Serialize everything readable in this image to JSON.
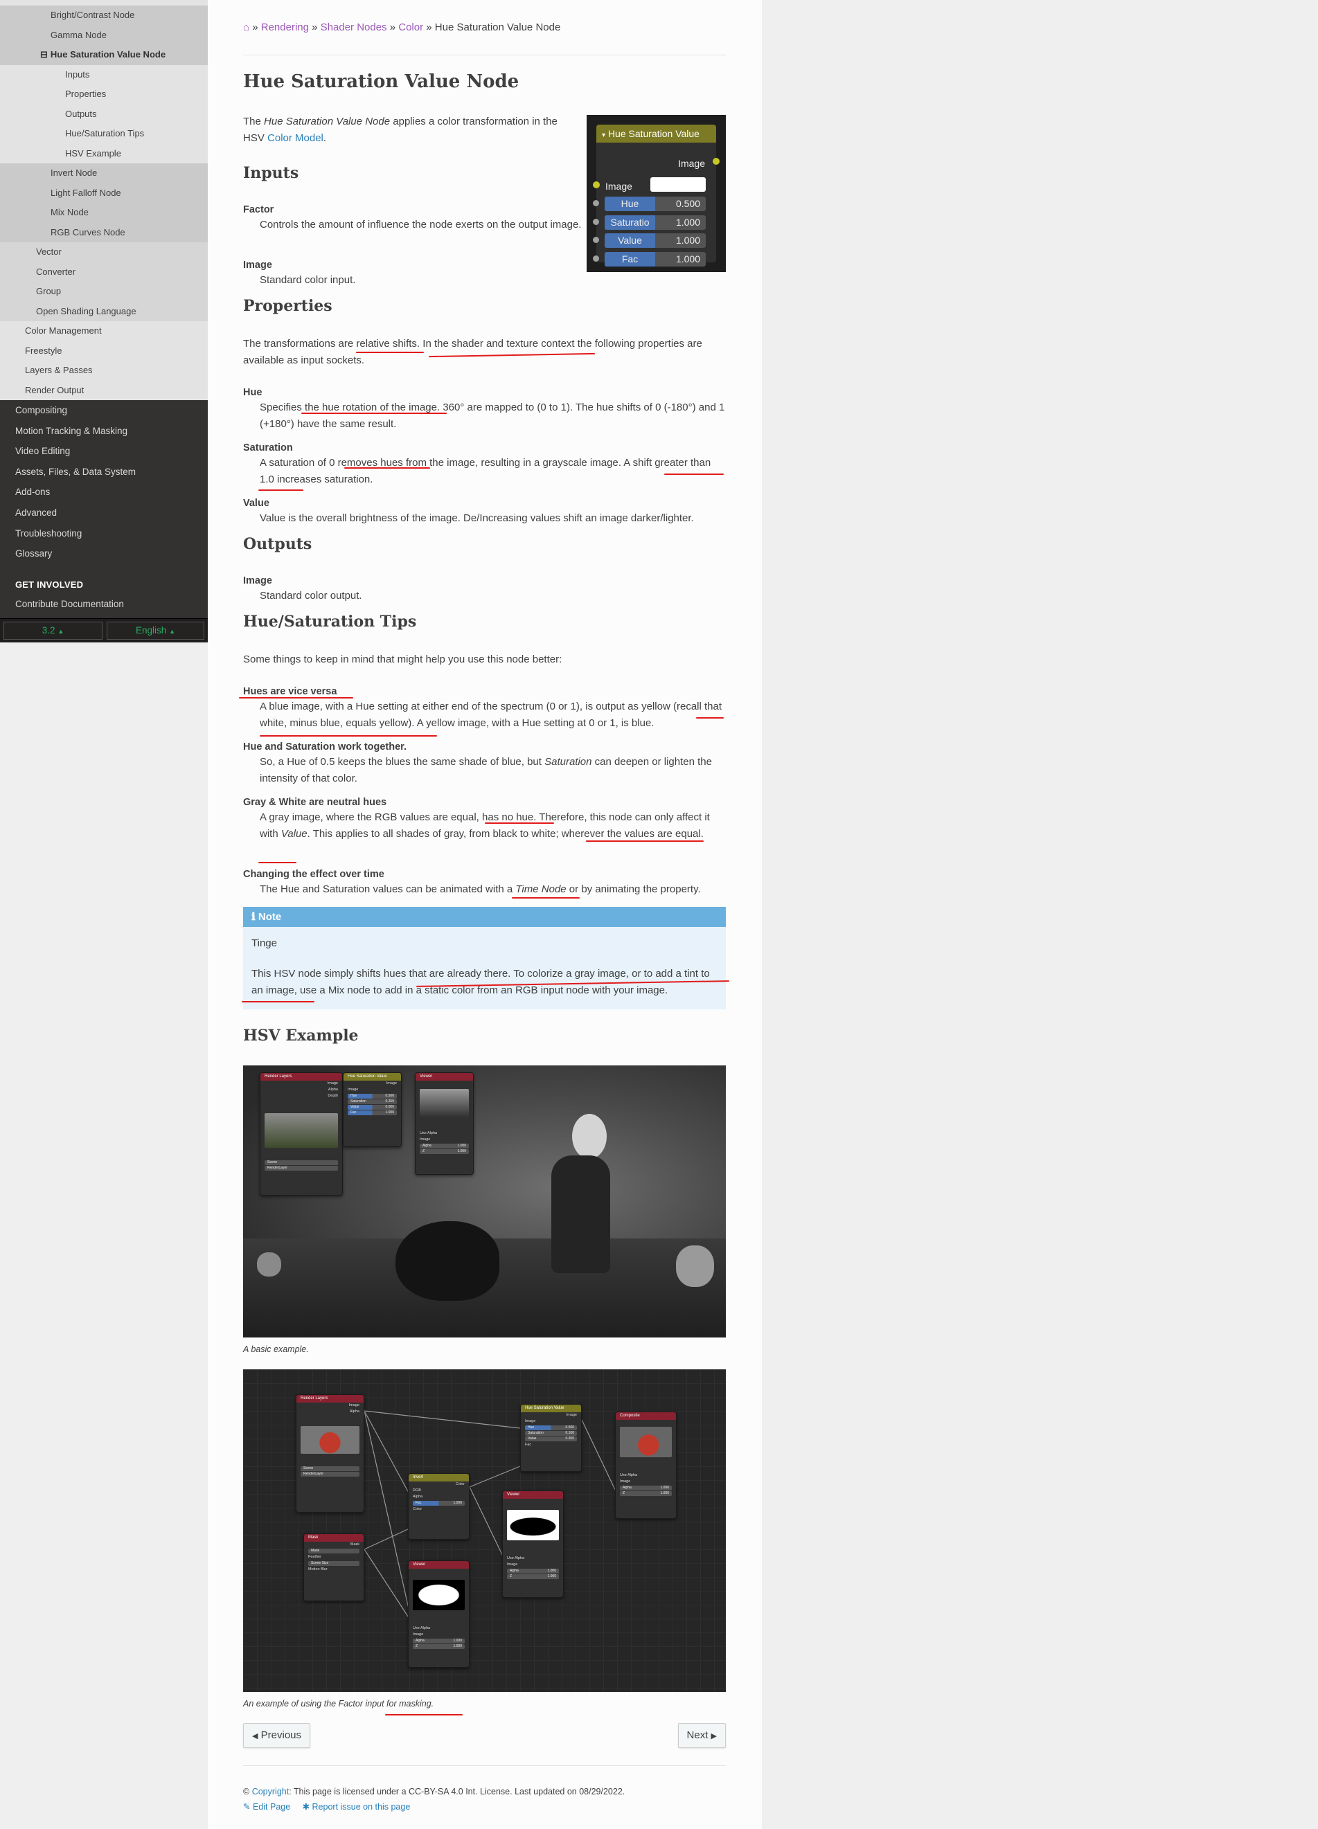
{
  "sidebar": {
    "items": [
      {
        "label": "Bright/Contrast Node",
        "level": 3
      },
      {
        "label": "Gamma Node",
        "level": 3
      },
      {
        "label": "Hue Saturation Value Node",
        "level": 3,
        "current": true,
        "toggle": "⊟"
      },
      {
        "label": "Inputs",
        "level": 4
      },
      {
        "label": "Properties",
        "level": 4
      },
      {
        "label": "Outputs",
        "level": 4
      },
      {
        "label": "Hue/Saturation Tips",
        "level": 4
      },
      {
        "label": "HSV Example",
        "level": 4
      },
      {
        "label": "Invert Node",
        "level": 3
      },
      {
        "label": "Light Falloff Node",
        "level": 3
      },
      {
        "label": "Mix Node",
        "level": 3
      },
      {
        "label": "RGB Curves Node",
        "level": 3
      },
      {
        "label": "Vector",
        "level": 2
      },
      {
        "label": "Converter",
        "level": 2
      },
      {
        "label": "Group",
        "level": 2
      },
      {
        "label": "Open Shading Language",
        "level": 2
      },
      {
        "label": "Color Management",
        "level": 1
      },
      {
        "label": "Freestyle",
        "level": 1
      },
      {
        "label": "Layers & Passes",
        "level": 1
      },
      {
        "label": "Render Output",
        "level": 1
      }
    ],
    "top_items": [
      "Compositing",
      "Motion Tracking & Masking",
      "Video Editing",
      "Assets, Files, & Data System",
      "Add-ons",
      "Advanced",
      "Troubleshooting",
      "Glossary"
    ],
    "caption": "GET INVOLVED",
    "contribute": "Contribute Documentation",
    "version": "3.2",
    "language": "English",
    "caret": "▲"
  },
  "breadcrumb": {
    "home_icon": "⌂",
    "sep": "»",
    "items": [
      "Rendering",
      "Shader Nodes",
      "Color"
    ],
    "current": "Hue Saturation Value Node"
  },
  "page": {
    "title": "Hue Saturation Value Node",
    "intro": {
      "p1": "The ",
      "em": "Hue Saturation Value Node",
      "p2": " applies a color transformation in the HSV ",
      "link": "Color Model",
      "p3": "."
    },
    "inputs": {
      "heading": "Inputs",
      "items": [
        {
          "term": "Factor",
          "def": "Controls the amount of influence the node exerts on the output image."
        },
        {
          "term": "Image",
          "def": "Standard color input."
        }
      ]
    },
    "properties": {
      "heading": "Properties",
      "intro": "The transformations are relative shifts. In the shader and texture context the following properties are available as input sockets.",
      "items": [
        {
          "term": "Hue",
          "def": "Specifies the hue rotation of the image. 360° are mapped to (0 to 1). The hue shifts of 0 (-180°) and 1 (+180°) have the same result."
        },
        {
          "term": "Saturation",
          "def": "A saturation of 0 removes hues from the image, resulting in a grayscale image. A shift greater than 1.0 increases saturation."
        },
        {
          "term": "Value",
          "def": "Value is the overall brightness of the image. De/Increasing values shift an image darker/lighter."
        }
      ]
    },
    "outputs": {
      "heading": "Outputs",
      "items": [
        {
          "term": "Image",
          "def": "Standard color output."
        }
      ]
    },
    "tips": {
      "heading": "Hue/Saturation Tips",
      "intro": "Some things to keep in mind that might help you use this node better:",
      "items": [
        {
          "term": "Hues are vice versa",
          "def": "A blue image, with a Hue setting at either end of the spectrum (0 or 1), is output as yellow (recall that white, minus blue, equals yellow). A yellow image, with a Hue setting at 0 or 1, is blue."
        },
        {
          "term": "Hue and Saturation work together.",
          "def_a": "So, a Hue of 0.5 keeps the blues the same shade of blue, but ",
          "def_em": "Saturation",
          "def_b": " can deepen or lighten the intensity of that color."
        },
        {
          "term": "Gray & White are neutral hues",
          "def_a": "A gray image, where the RGB values are equal, has no hue. Therefore, this node can only affect it with ",
          "def_em": "Value",
          "def_b": ". This applies to all shades of gray, from black to white; wherever the values are equal."
        },
        {
          "term": "Changing the effect over time",
          "def_a": "The Hue and Saturation values can be animated with a ",
          "def_em": "Time Node",
          "def_b": " or by animating the property."
        }
      ]
    },
    "note": {
      "icon": "ℹ",
      "title": "Note",
      "subtitle": "Tinge",
      "body": "This HSV node simply shifts hues that are already there. To colorize a gray image, or to add a tint to an image, use a Mix node to add in a static color from an RGB input node with your image."
    },
    "example": {
      "heading": "HSV Example",
      "caption1": "A basic example.",
      "caption2": "An example of using the Factor input for masking."
    },
    "nav": {
      "prev": "Previous",
      "next": "Next",
      "prev_icon": "◀",
      "next_icon": "▶"
    },
    "footer": {
      "copy_sym": "©",
      "copyright_link": "Copyright",
      "license": ": This page is licensed under a CC-BY-SA 4.0 Int. License. Last updated on 08/29/2022.",
      "edit": "Edit Page",
      "report": "Report issue on this page",
      "edit_icon": "✎",
      "report_icon": "✱"
    }
  },
  "node_widget": {
    "title": "Hue Saturation Value",
    "output": "Image",
    "image_label": "Image",
    "fields": [
      {
        "label": "Hue",
        "value": "0.500"
      },
      {
        "label": "Saturatio",
        "value": "1.000"
      },
      {
        "label": "Value",
        "value": "1.000"
      },
      {
        "label": "Fac",
        "value": "1.000"
      }
    ],
    "colors": {
      "header": "#7c7a24",
      "socket": "#c7c729",
      "field": "#4772b3"
    }
  },
  "example_nodes": {
    "render_layers": "Render Layers",
    "hsv": "Hue Saturation Value",
    "viewer": "Viewer",
    "composite": "Composite",
    "invert": "Invert",
    "mask": "Mask",
    "image": "Image",
    "alpha": "Alpha",
    "depth": "Depth",
    "hue": "Hue",
    "saturation": "Saturation",
    "value": "Value",
    "fac": "Fac",
    "use_alpha": "Use Alpha",
    "scene": "Scene",
    "render_layer": "RenderLayer",
    "color": "Color",
    "rgb": "RGB",
    "feather": "Feather",
    "scene_size": "Scene Size",
    "motion_blur": "Motion Blur",
    "z": "Z",
    "v_0500": "0.500",
    "v_0250": "0.250",
    "v_0000": "0.000",
    "v_1000": "1.000",
    "v_0100": "0.100",
    "v_0300": "0.300"
  }
}
